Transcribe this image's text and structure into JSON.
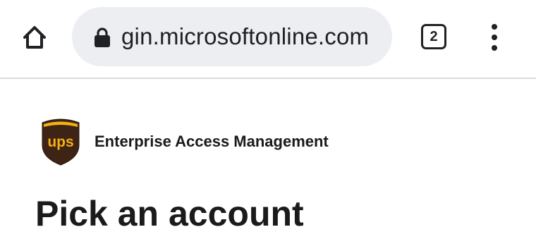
{
  "browser": {
    "url": "gin.microsoftonline.com",
    "tab_count": "2",
    "icons": {
      "home": "home-icon",
      "lock": "lock-icon",
      "tabs": "tab-switcher-icon",
      "menu": "overflow-menu-icon"
    }
  },
  "page": {
    "brand_name": "Enterprise Access Management",
    "logo_text": "ups",
    "title": "Pick an account"
  },
  "colors": {
    "url_bar_bg": "#eceef1",
    "ups_brown": "#3d2415",
    "ups_gold": "#f5b014",
    "text": "#1b1b1b"
  }
}
